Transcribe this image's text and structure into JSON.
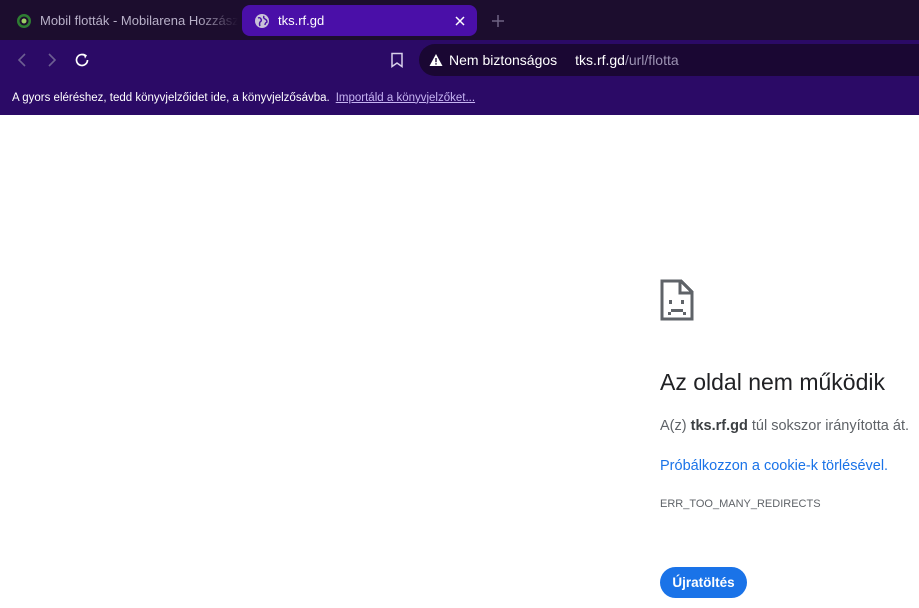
{
  "tabs": [
    {
      "title": "Mobil flották - Mobilarena Hozzászólások",
      "active": false,
      "favicon": "mobilarena-logo-icon"
    },
    {
      "title": "tks.rf.gd",
      "active": true,
      "favicon": "globe-icon"
    }
  ],
  "toolbar": {
    "back_icon": "back-arrow-icon",
    "forward_icon": "forward-arrow-icon",
    "reload_icon": "reload-icon",
    "bookmark_icon": "bookmark-icon"
  },
  "omnibox": {
    "security_label": "Nem biztonságos",
    "host": "tks.rf.gd",
    "path": "/url/flotta"
  },
  "bookmarks_bar": {
    "prompt": "A gyors eléréshez, tedd könyvjelzőidet ide, a könyvjelzősávba.",
    "import_link": "Importáld a könyvjelzőket..."
  },
  "error_page": {
    "icon": "sad-page-icon",
    "title": "Az oldal nem működik",
    "desc_prefix": "A(z)",
    "desc_host": "tks.rf.gd",
    "desc_suffix": "túl sokszor irányította át.",
    "suggestion": "Próbálkozzon a cookie-k törlésével.",
    "error_code": "ERR_TOO_MANY_REDIRECTS",
    "reload_button": "Újratöltés"
  },
  "colors": {
    "tabstrip_bg": "#1c0d2e",
    "active_tab_bg": "#4a0fa8",
    "toolbar_bg": "#2b0a66",
    "link_blue": "#1a73e8"
  }
}
